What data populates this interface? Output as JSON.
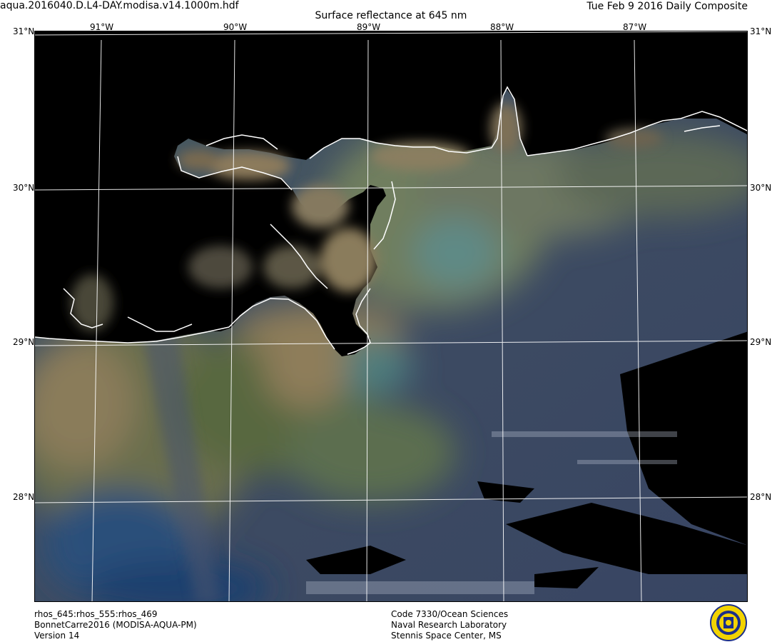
{
  "header": {
    "filename": "aqua.2016040.D.L4-DAY.modisa.v14.1000m.hdf",
    "title": "Surface reflectance at 645 nm",
    "date": "Tue Feb  9 2016 Daily Composite"
  },
  "longitude_labels": [
    "91°W",
    "90°W",
    "89°W",
    "88°W",
    "87°W"
  ],
  "latitude_labels": [
    "31°N",
    "30°N",
    "29°N",
    "28°N"
  ],
  "footer_left": [
    "rhos_645:rhos_555:rhos_469",
    "BonnetCarre2016 (MODISA-AQUA-PM)",
    "Version 14"
  ],
  "footer_mid": [
    "Code 7330/Ocean Sciences",
    "Naval Research Laboratory",
    "Stennis Space Center, MS"
  ],
  "colors": {
    "land": "#000000",
    "coastline": "#ffffff",
    "gridline": "#ffffff",
    "turbid_water": "#8a7a5a",
    "green_water": "#4f6e52",
    "offshore_water": "#3c4a63",
    "deep_blue_water": "#1f3f6e"
  },
  "logo": {
    "icon": "nrl-seal-icon"
  }
}
